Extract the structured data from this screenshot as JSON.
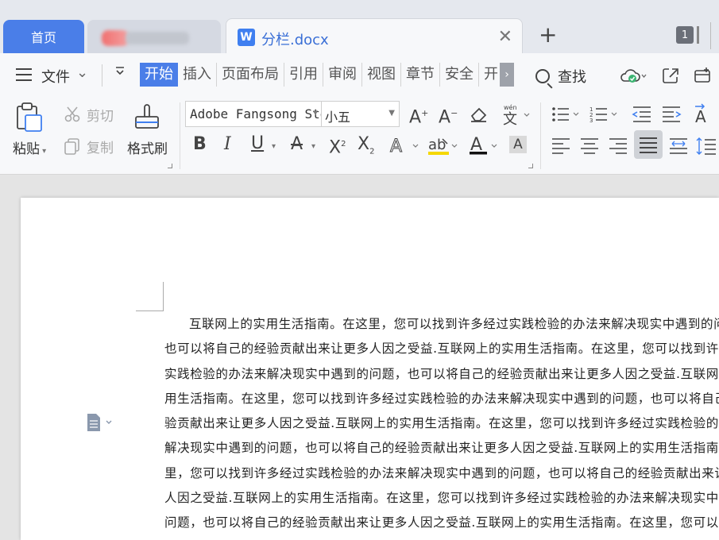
{
  "tabs": {
    "home_label": "首页",
    "doc_title": "分栏.docx",
    "doc_icon": "W",
    "window_count": "1"
  },
  "menu": {
    "hamburger_icon": "hamburger-icon",
    "file_label": "文件",
    "tabs": [
      "开始",
      "插入",
      "页面布局",
      "引用",
      "审阅",
      "视图",
      "章节",
      "安全",
      "开"
    ],
    "active_tab": "开始",
    "search_label": "查找"
  },
  "ribbon": {
    "paste_label": "粘贴",
    "cut_label": "剪切",
    "copy_label": "复制",
    "format_painter_label": "格式刷",
    "font_name": "Adobe Fangsong Std",
    "font_size": "小五"
  },
  "document": {
    "lines": [
      "互联网上的实用生活指南。在这里，您可以找到许多经过实践检验的办法来解决现实中遇到的问题，",
      "也可以将自己的经验贡献出来让更多人因之受益.互联网上的实用生活指南。在这里，您可以找到许多经过",
      "实践检验的办法来解决现实中遇到的问题，也可以将自己的经验贡献出来让更多人因之受益.互联网上的实",
      "用生活指南。在这里，您可以找到许多经过实践检验的办法来解决现实中遇到的问题，也可以将自己的经",
      "验贡献出来让更多人因之受益.互联网上的实用生活指南。在这里，您可以找到许多经过实践检验的办法来",
      "解决现实中遇到的问题，也可以将自己的经验贡献出来让更多人因之受益.互联网上的实用生活指南。在这",
      "里，您可以找到许多经过实践检验的办法来解决现实中遇到的问题，也可以将自己的经验贡献出来让更多",
      "人因之受益.互联网上的实用生活指南。在这里，您可以找到许多经过实践检验的办法来解决现实中遇到的",
      "问题，也可以将自己的经验贡献出来让更多人因之受益.互联网上的实用生活指南。在这里，您可以找到许"
    ]
  },
  "colors": {
    "accent": "#4a7ee8",
    "doc_title": "#3a6fd6"
  }
}
